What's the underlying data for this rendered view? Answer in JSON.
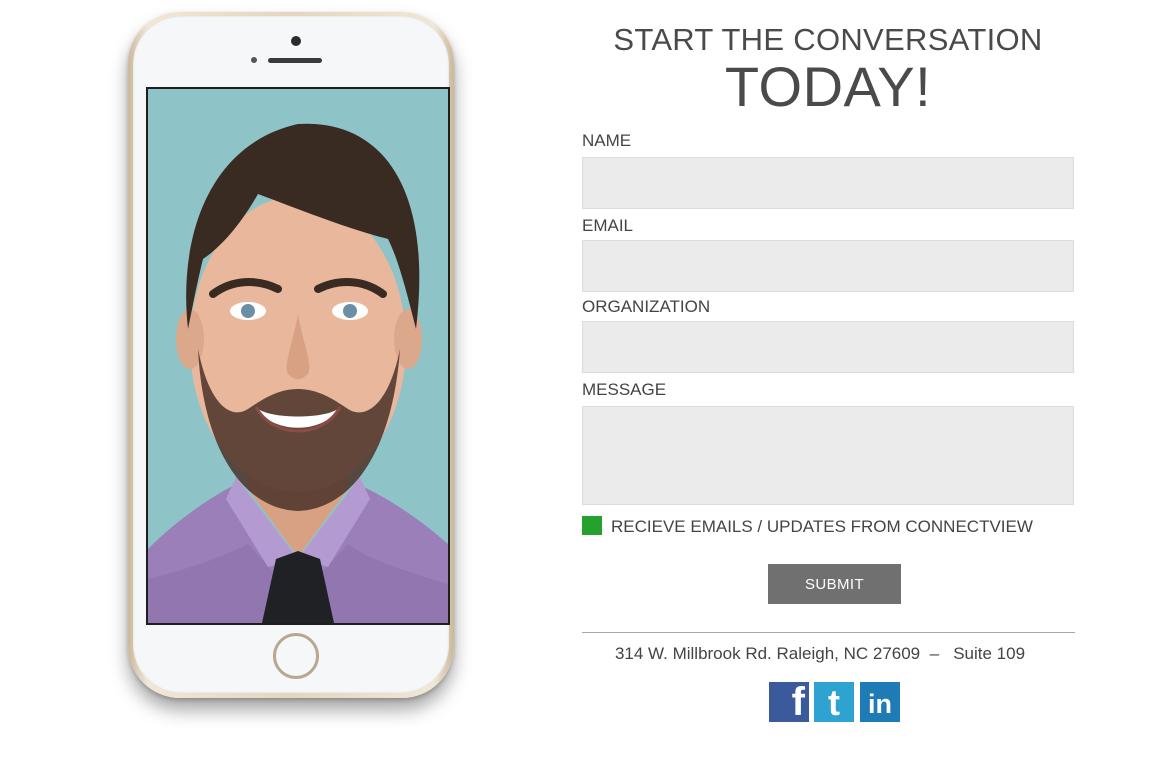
{
  "header": {
    "line1": "START THE CONVERSATION",
    "line2": "TODAY!"
  },
  "form": {
    "name_label": "NAME",
    "name_value": "",
    "email_label": "EMAIL",
    "email_value": "",
    "organization_label": "ORGANIZATION",
    "organization_value": "",
    "message_label": "MESSAGE",
    "message_value": "",
    "optin_label": "RECIEVE EMAILS / UPDATES FROM CONNECTVIEW",
    "optin_checked": true,
    "optin_color": "#27a12d",
    "submit_label": "SUBMIT"
  },
  "footer": {
    "address": "314 W. Millbrook Rd. Raleigh, NC 27609  –   Suite 109",
    "social": [
      {
        "icon": "facebook-icon",
        "glyph": "f",
        "color": "#3b5a9b"
      },
      {
        "icon": "twitter-icon",
        "glyph": "t",
        "color": "#2ea2d1"
      },
      {
        "icon": "linkedin-icon",
        "glyph": "in",
        "color": "#1f7bb6"
      }
    ]
  },
  "phone": {
    "photo_subject": "portrait-photo",
    "colors": {
      "background": "#8ec4c8",
      "shirt": "#9b7fb8",
      "tie": "#1f2124",
      "hair": "#3a2b22",
      "skin": "#e8b79c"
    }
  }
}
